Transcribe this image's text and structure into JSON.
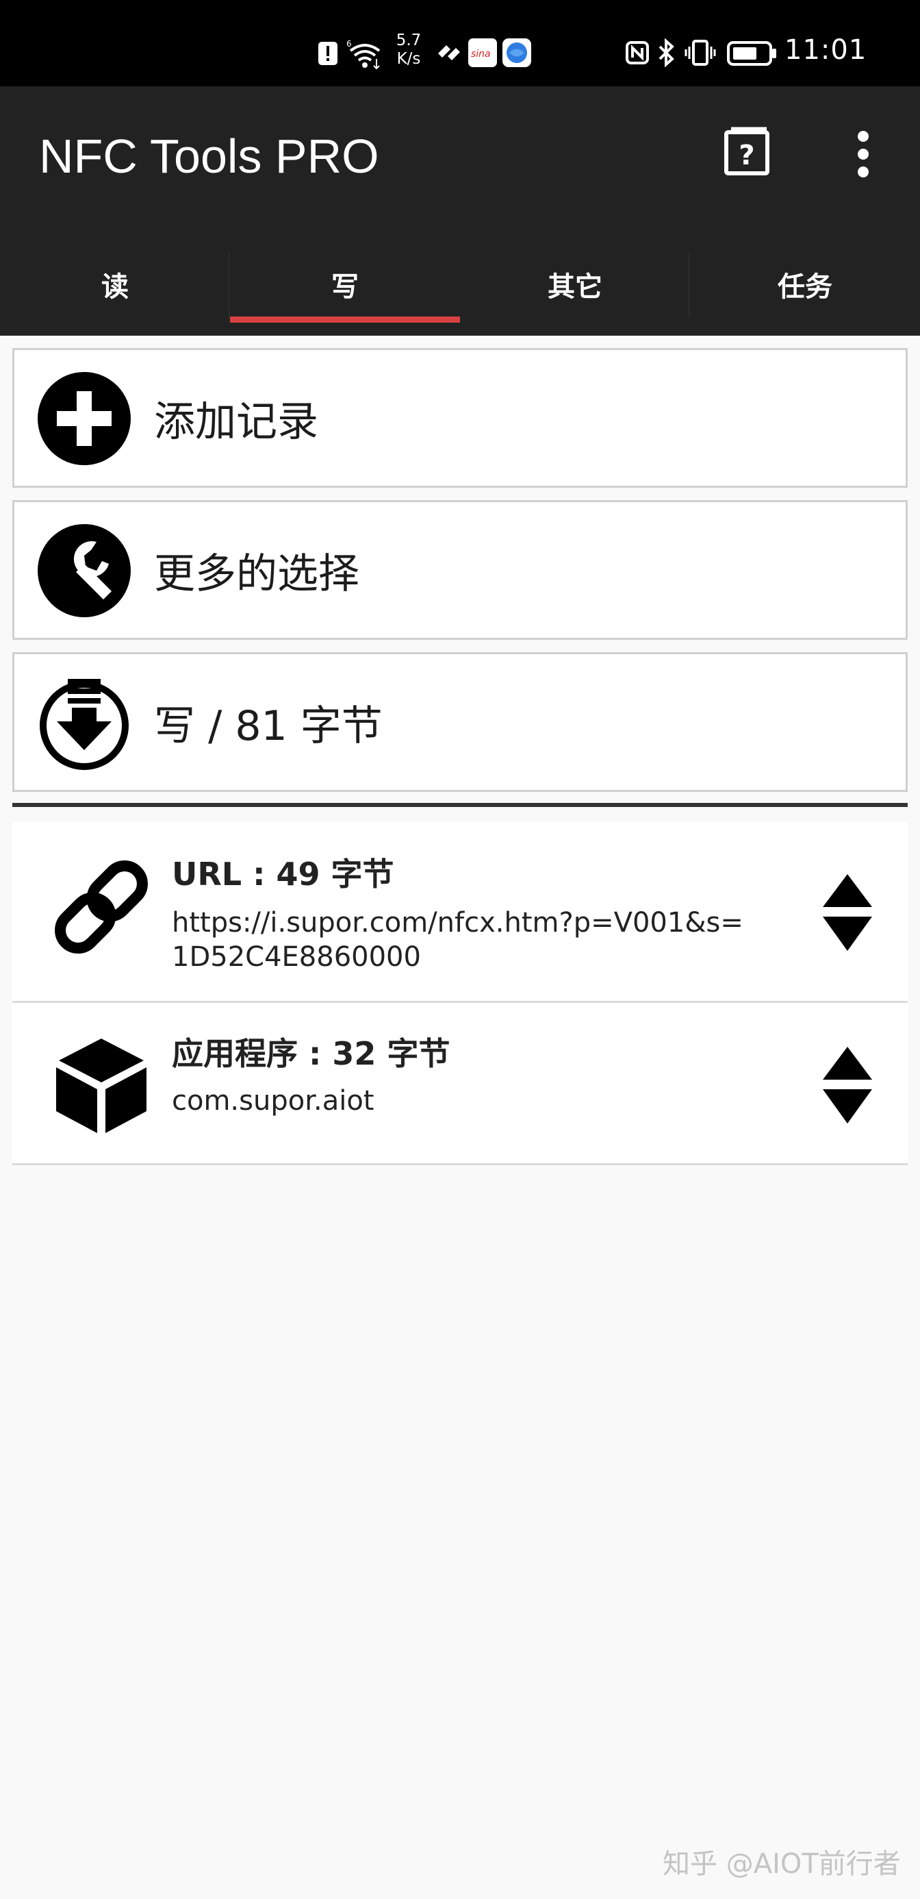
{
  "status_bar": {
    "speed": "5.7\nK/s",
    "speed_value": "5.7",
    "speed_unit": "K/s",
    "time": "11:01",
    "icons": [
      "alert-icon",
      "wifi-icon",
      "huawei-share-icon",
      "sina-icon",
      "browser-icon",
      "nfc-icon",
      "bluetooth-icon",
      "vibrate-icon",
      "battery-icon"
    ]
  },
  "app_bar": {
    "title": "NFC Tools PRO",
    "icons": [
      "help-icon",
      "more-vert-icon"
    ]
  },
  "tabs": [
    {
      "label": "读",
      "active": false
    },
    {
      "label": "写",
      "active": true
    },
    {
      "label": "其它",
      "active": false
    },
    {
      "label": "任务",
      "active": false
    }
  ],
  "actions": [
    {
      "label": "添加记录",
      "icon": "add-circle-icon"
    },
    {
      "label": "更多的选择",
      "icon": "wrench-icon"
    },
    {
      "label": "写 / 81 字节",
      "icon": "download-write-icon"
    }
  ],
  "records": [
    {
      "icon": "link-icon",
      "title": "URL : 49 字节",
      "value_line1": "https://i.supor.com/nfcx.htm?p=V001&s=",
      "value_line2": "1D52C4E8860000"
    },
    {
      "icon": "package-cube-icon",
      "title": "应用程序 : 32 字节",
      "value_line1": "com.supor.aiot"
    }
  ],
  "watermark": "知乎 @AIOT前行者",
  "colors": {
    "status_bar": "#000000",
    "app_bar": "#222222",
    "tab_indicator": "#d64141",
    "background": "#f9f9f9"
  }
}
